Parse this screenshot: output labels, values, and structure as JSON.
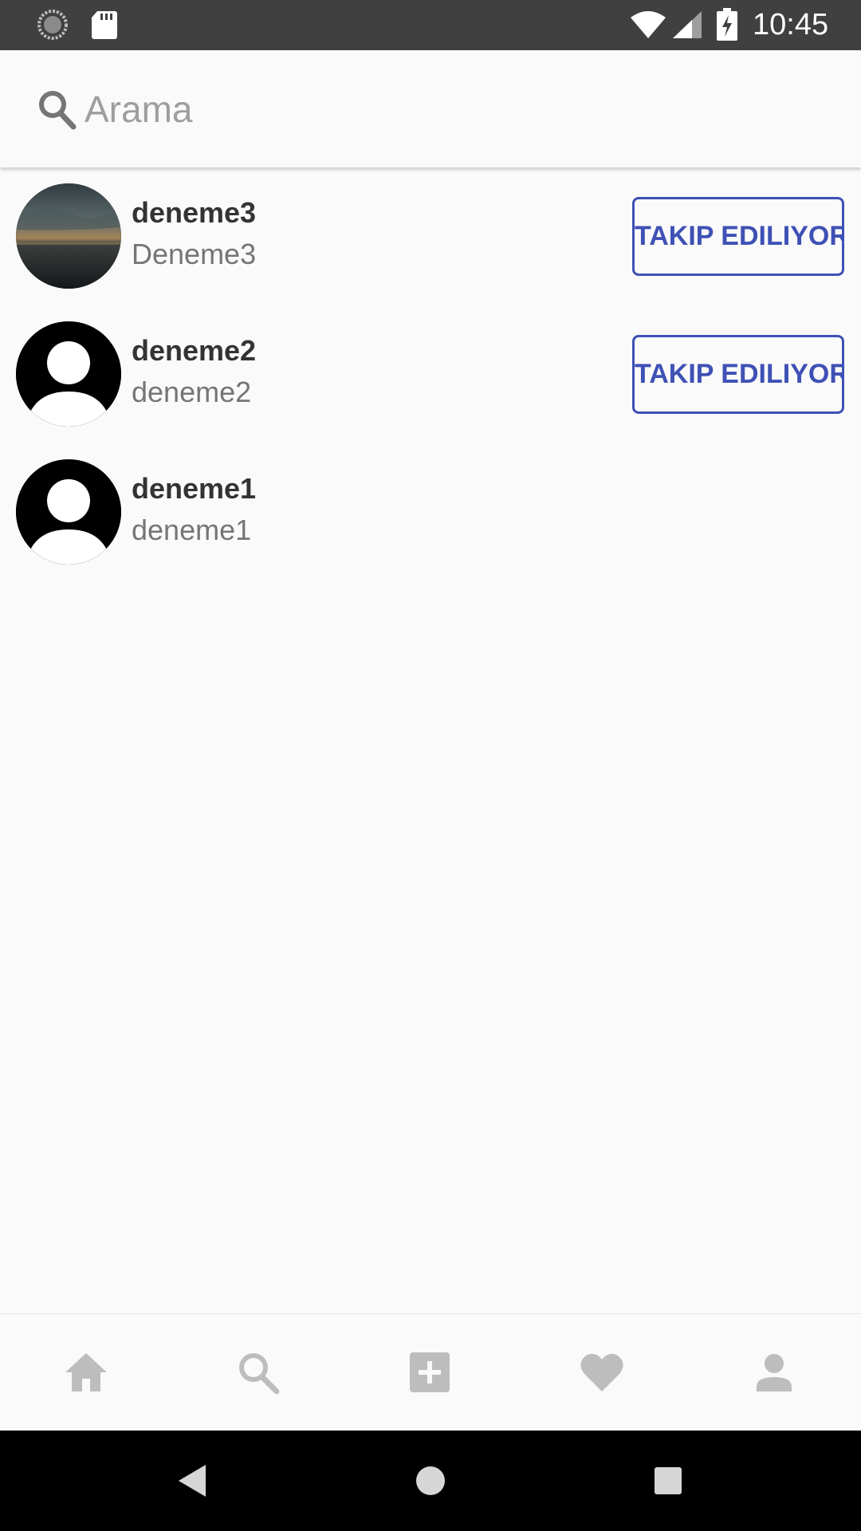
{
  "status_bar": {
    "time": "10:45",
    "icons": [
      "sync-icon",
      "sd-card-icon",
      "wifi-icon",
      "signal-icon",
      "battery-charging-icon"
    ]
  },
  "search": {
    "placeholder": "Arama",
    "value": "",
    "icon": "search-icon"
  },
  "users": [
    {
      "username": "deneme3",
      "fullname": "Deneme3",
      "avatar": "photo-avatar",
      "follow_label": "TAKIP EDILIYOR"
    },
    {
      "username": "deneme2",
      "fullname": "deneme2",
      "avatar": "default-avatar-icon",
      "follow_label": "TAKIP EDILIYOR"
    },
    {
      "username": "deneme1",
      "fullname": "deneme1",
      "avatar": "default-avatar-icon",
      "follow_label": ""
    }
  ],
  "bottom_nav": {
    "items": [
      "home-icon",
      "search-icon",
      "add-post-icon",
      "heart-icon",
      "profile-icon"
    ]
  },
  "system_nav": {
    "items": [
      "back-icon",
      "home-circle-icon",
      "recents-icon"
    ]
  },
  "colors": {
    "accent": "#3f51b5",
    "status_bar": "#404040",
    "background": "#fafafa",
    "nav_icon": "#bdbdbd"
  }
}
